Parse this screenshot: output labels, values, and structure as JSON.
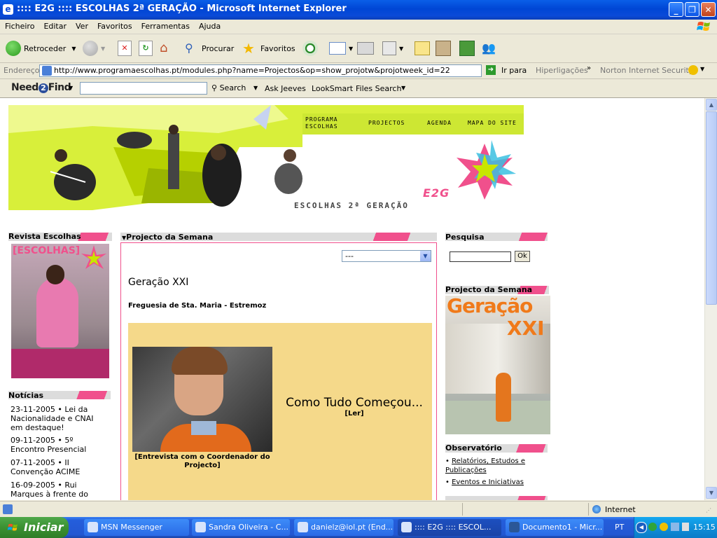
{
  "window": {
    "title": ":::: E2G :::: ESCOLHAS 2ª GERAÇÃO - Microsoft Internet Explorer"
  },
  "menu": [
    "Ficheiro",
    "Editar",
    "Ver",
    "Favoritos",
    "Ferramentas",
    "Ajuda"
  ],
  "toolbar": {
    "back": "Retroceder",
    "search": "Procurar",
    "favorites": "Favoritos"
  },
  "address": {
    "label": "Endereço",
    "url": "http://www.programaescolhas.pt/modules.php?name=Projectos&op=show_projotw&projotweek_id=22",
    "go": "Ir para",
    "links": "Hiperligações",
    "norton": "Norton Internet Security"
  },
  "n2f": {
    "brand_a": "Need",
    "brand_num": "2",
    "brand_b": "Find",
    "search": "Search",
    "ask": "Ask Jeeves",
    "looksmart": "LookSmart",
    "files": "Files Search"
  },
  "banner": {
    "nav": [
      "PROGRAMA ESCOLHAS",
      "PROJECTOS",
      "AGENDA",
      "MAPA DO SITE"
    ],
    "logo": "E2G",
    "tagline": "ESCOLHAS 2ª GERAÇÃO"
  },
  "left": {
    "revista_title": "Revista Escolhas",
    "magazine_name": "[ESCOLHAS]",
    "noticias_title": "Notícias",
    "news": [
      {
        "date": "23-11-2005",
        "text": "Lei da Nacionalidade e CNAI em destaque!"
      },
      {
        "date": "09-11-2005",
        "text": "5º Encontro Presencial"
      },
      {
        "date": "07-11-2005",
        "text": "II Convenção ACIME"
      },
      {
        "date": "16-09-2005",
        "text": "Rui Marques à frente do"
      }
    ]
  },
  "center": {
    "header": "Projecto da Semana",
    "select_value": "---",
    "project_title": "Geração XXI",
    "subtitle": "Freguesia de Sta. Maria - Estremoz",
    "photo_caption": "[Entrevista com o Coordenador do Projecto]",
    "story_title": "Como Tudo Começou...",
    "read_link": "[Ler]"
  },
  "right": {
    "pesquisa_title": "Pesquisa",
    "ok": "Ok",
    "pds_title": "Projecto da Semana",
    "pds_image_text_1": "Geração",
    "pds_image_text_2": "XXI",
    "obs_title": "Observatório",
    "obs_links": [
      "Relatórios, Estudos e Publicações",
      "Eventos e Iniciativas"
    ]
  },
  "status": {
    "zone": "Internet"
  },
  "taskbar": {
    "start": "Iniciar",
    "tasks": [
      "MSN Messenger",
      "Sandra Oliveira - C...",
      "danielz@iol.pt (End...",
      ":::: E2G :::: ESCOL...",
      "Documento1 - Micr..."
    ],
    "lang": "PT",
    "clock": "15:15"
  },
  "colors": {
    "pink": "#f0508c",
    "lime": "#c8e600",
    "beige": "#f5d98a"
  }
}
